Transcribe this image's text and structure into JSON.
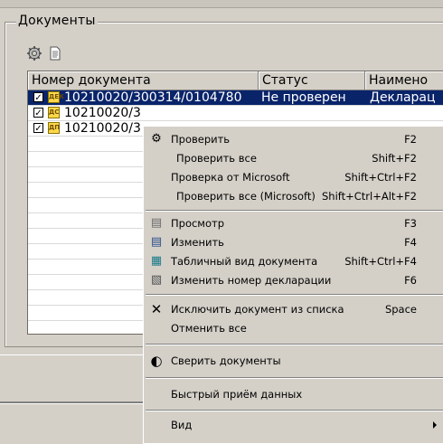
{
  "group": {
    "title": "Документы"
  },
  "toolbar": {
    "icons": [
      "gear-icon",
      "document-icon"
    ]
  },
  "columns": [
    "Номер документа",
    "Статус",
    "Наимено"
  ],
  "rows": [
    {
      "checked": true,
      "type": "ДЕК",
      "number": "10210020/300314/0104780",
      "status": "Не проверен",
      "name": "Декларац"
    },
    {
      "checked": true,
      "type": "ДС",
      "number": "10210020/3",
      "status": "",
      "name": ""
    },
    {
      "checked": true,
      "type": "ДП",
      "number": "10210020/3",
      "status": "",
      "name": ""
    }
  ],
  "checkmark": "✓",
  "context_menu": {
    "items": [
      {
        "icon": "gear-icon",
        "glyph": "⚙",
        "label": "Проверить",
        "shortcut": "F2"
      },
      {
        "icon": "",
        "glyph": "",
        "label": "Проверить все",
        "shortcut": "Shift+F2"
      },
      {
        "icon": "",
        "glyph": "",
        "label": "Проверка от Microsoft",
        "shortcut": "Shift+Ctrl+F2"
      },
      {
        "icon": "",
        "glyph": "",
        "label": "Проверить все (Microsoft)",
        "shortcut": "Shift+Ctrl+Alt+F2"
      },
      {
        "icon": "document-icon",
        "glyph": "▤",
        "label": "Просмотр",
        "shortcut": "F3"
      },
      {
        "icon": "edit-document-icon",
        "glyph": "▤",
        "label": "Изменить",
        "shortcut": "F4"
      },
      {
        "icon": "table-icon",
        "glyph": "▦",
        "label": "Табличный вид документа",
        "shortcut": "Shift+Ctrl+F4"
      },
      {
        "icon": "renumber-icon",
        "glyph": "▧",
        "label": "Изменить номер декларации",
        "shortcut": "F6"
      },
      {
        "icon": "close-icon",
        "glyph": "✕",
        "label": "Исключить документ из списка",
        "shortcut": "Space"
      },
      {
        "icon": "",
        "glyph": "",
        "label": "Отменить все",
        "shortcut": ""
      },
      {
        "icon": "compare-icon",
        "glyph": "◐",
        "label": "Сверить документы",
        "shortcut": ""
      },
      {
        "icon": "",
        "glyph": "",
        "label": "Быстрый приём данных",
        "shortcut": ""
      },
      {
        "icon": "",
        "glyph": "",
        "label": "Вид",
        "shortcut": ""
      }
    ]
  }
}
